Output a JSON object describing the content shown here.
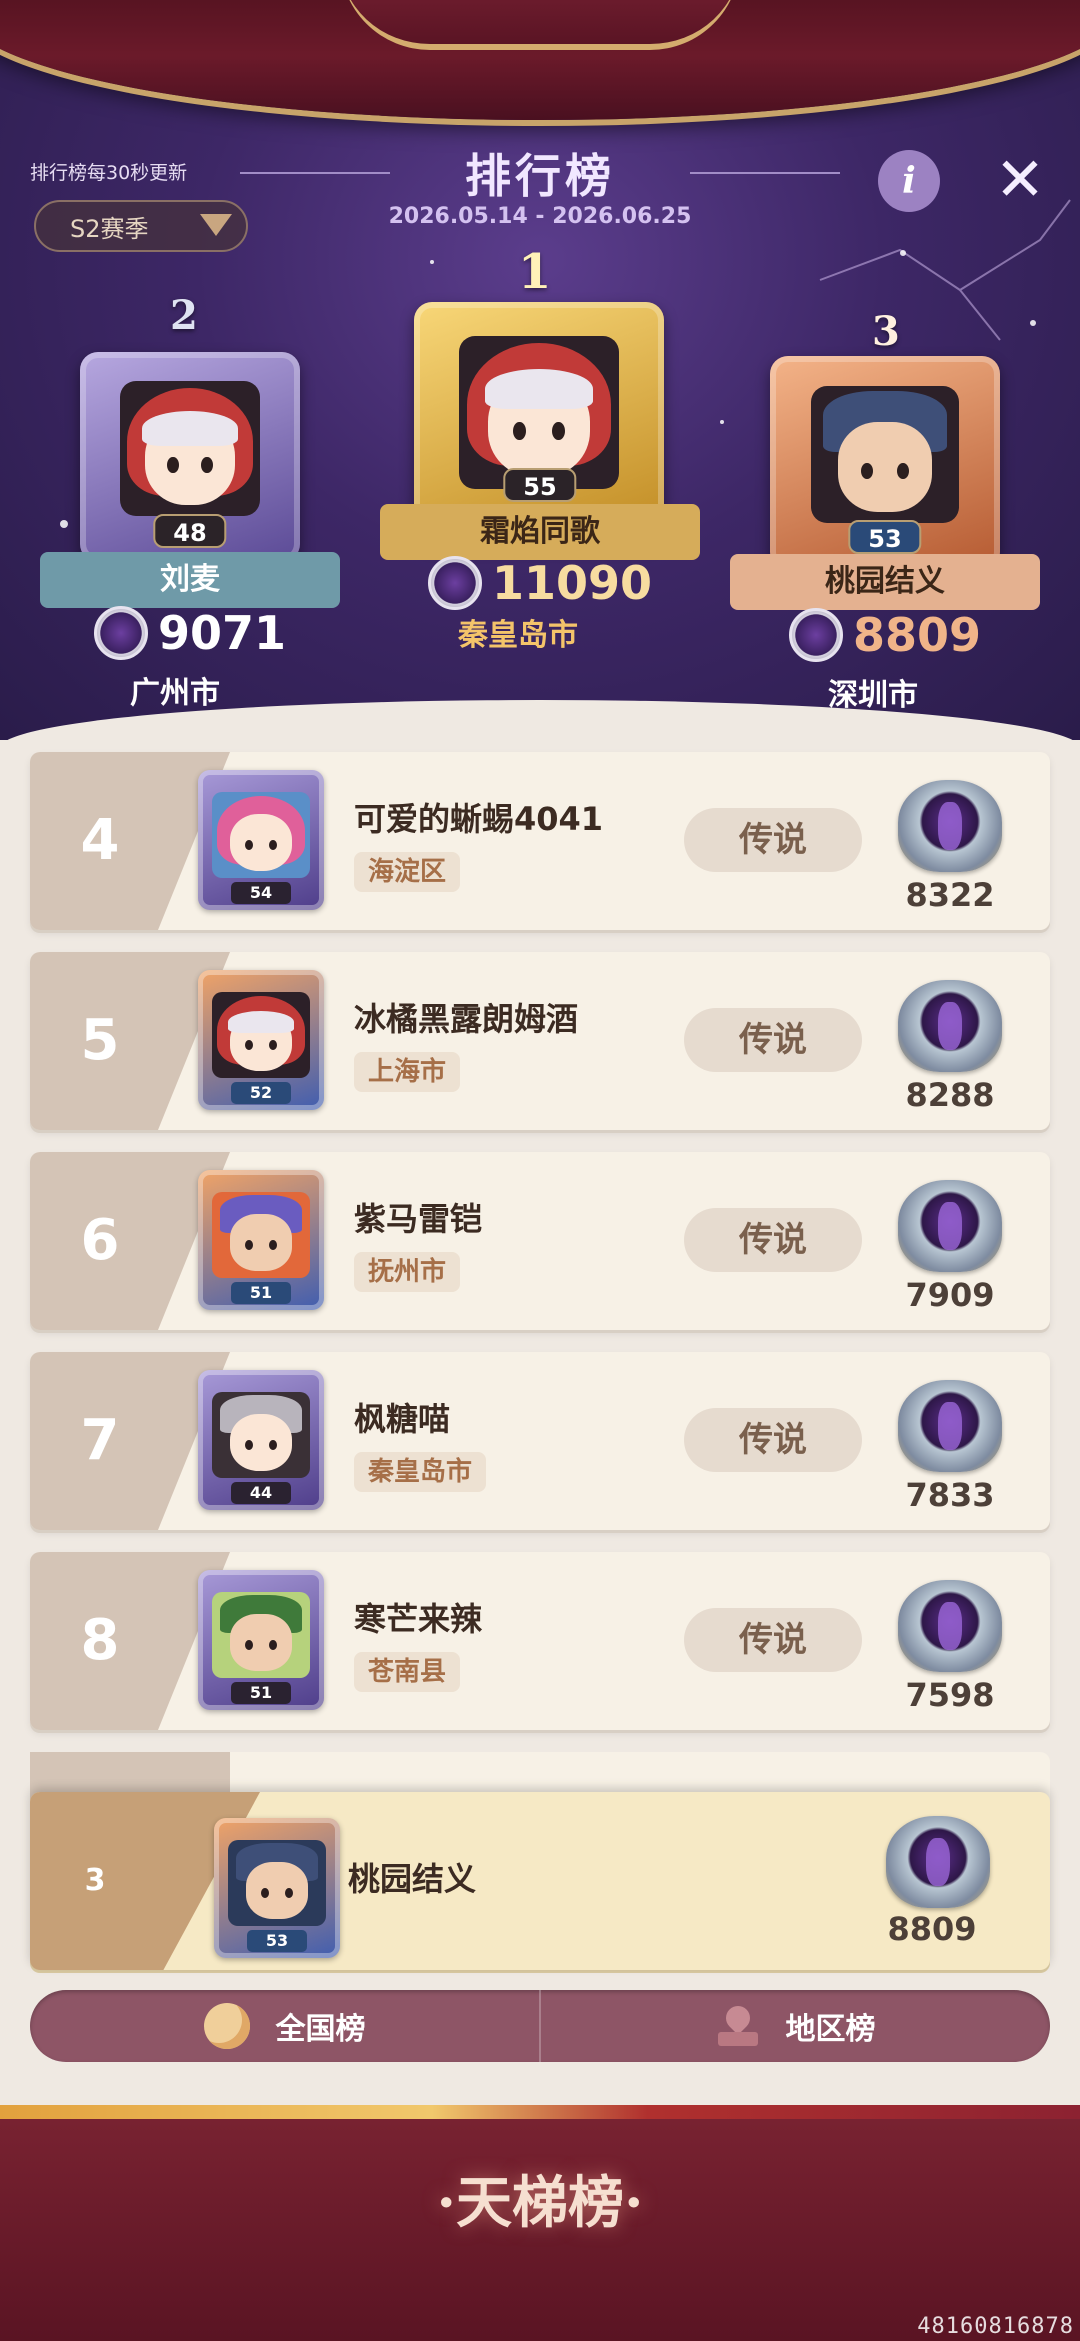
{
  "header": {
    "update_note": "排行榜每30秒更新",
    "season": "S2赛季",
    "title": "排行榜",
    "dates": "2026.05.14 - 2026.06.25",
    "info_label": "i",
    "close_label": "✕"
  },
  "podium": {
    "first": {
      "rank": "1",
      "name": "霜焰同歌",
      "level": "55",
      "score": "11090",
      "city": "秦皇岛市"
    },
    "second": {
      "rank": "2",
      "name": "刘麦",
      "level": "48",
      "score": "9071",
      "city": "广州市"
    },
    "third": {
      "rank": "3",
      "name": "桃园结义",
      "level": "53",
      "score": "8809",
      "city": "深圳市"
    }
  },
  "rows": [
    {
      "rank": "4",
      "name": "可爱的蜥蜴4041",
      "city": "海淀区",
      "level": "54",
      "tier": "传说",
      "score": "8322"
    },
    {
      "rank": "5",
      "name": "冰橘黑露朗姆酒",
      "city": "上海市",
      "level": "52",
      "tier": "传说",
      "score": "8288"
    },
    {
      "rank": "6",
      "name": "紫马雷铠",
      "city": "抚州市",
      "level": "51",
      "tier": "传说",
      "score": "7909"
    },
    {
      "rank": "7",
      "name": "枫糖喵",
      "city": "秦皇岛市",
      "level": "44",
      "tier": "传说",
      "score": "7833"
    },
    {
      "rank": "8",
      "name": "寒芒来辣",
      "city": "苍南县",
      "level": "51",
      "tier": "传说",
      "score": "7598"
    }
  ],
  "me": {
    "rank": "3",
    "name": "桃园结义",
    "level": "53",
    "score": "8809"
  },
  "tabs": {
    "national": "全国榜",
    "regional": "地区榜"
  },
  "bottom": {
    "title": "·天梯榜·",
    "uid": "48160816878"
  },
  "colors": {
    "accent": "#8e5566",
    "gold": "#e2a13d",
    "purple": "#3d2766"
  }
}
